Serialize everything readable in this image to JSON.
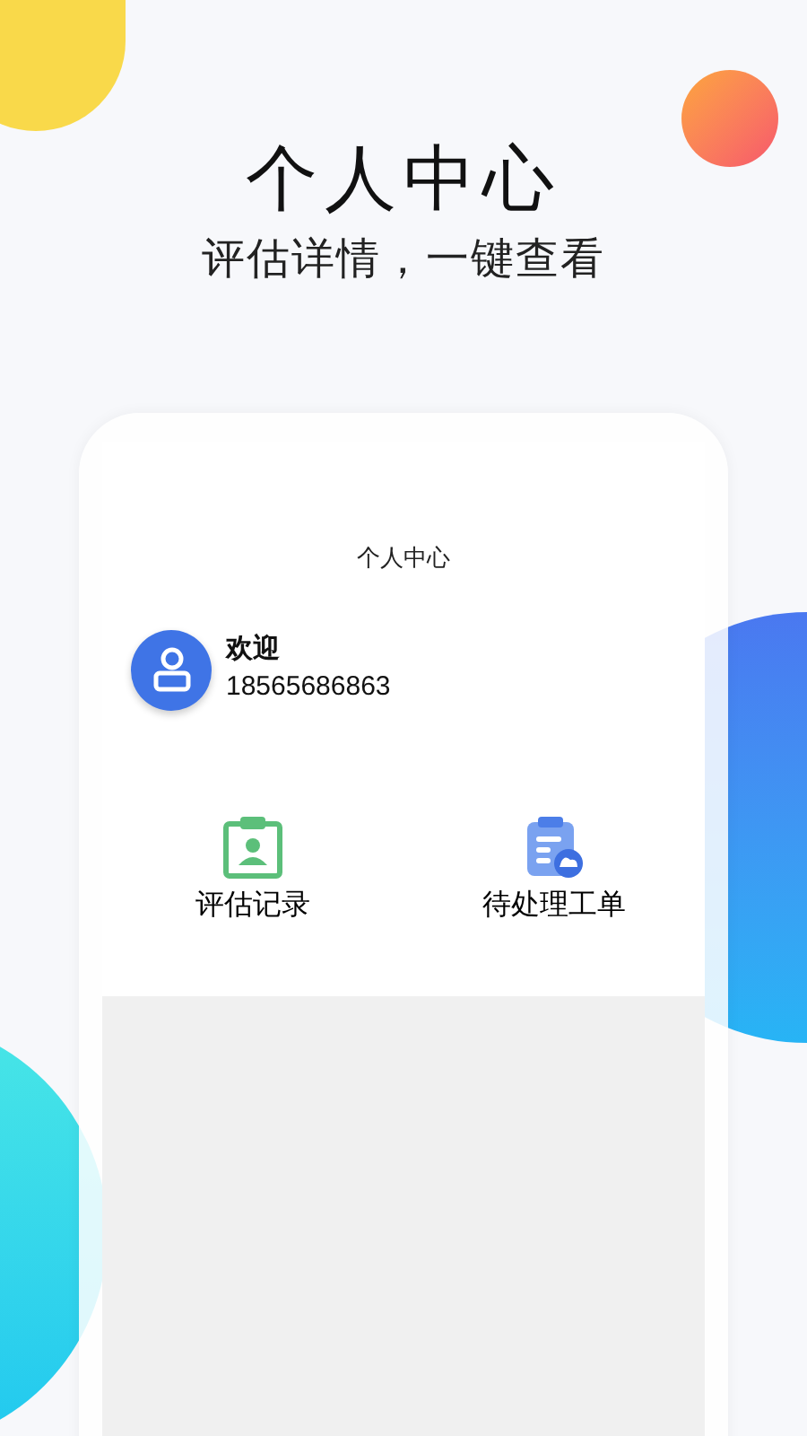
{
  "headline": "个人中心",
  "subheadline": "评估详情，一键查看",
  "screen": {
    "title": "个人中心",
    "greeting": "欢迎",
    "phone": "18565686863",
    "shortcuts": [
      {
        "kind": "records",
        "label": "评估记录"
      },
      {
        "kind": "orders",
        "label": "待处理工单"
      }
    ]
  }
}
